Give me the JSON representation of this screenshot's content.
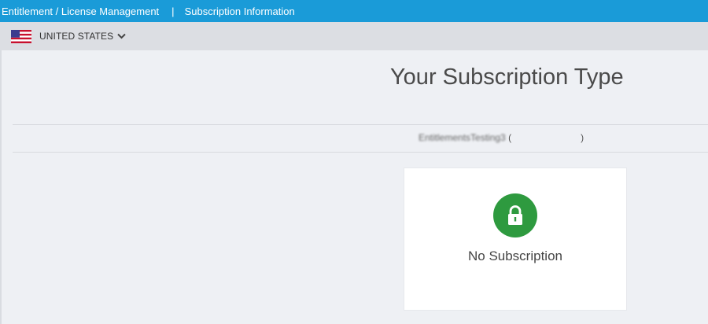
{
  "breadcrumb": {
    "item1": "Entitlement / License Management",
    "separator": "|",
    "item2": "Subscription Information"
  },
  "country": {
    "label": "UNITED STATES",
    "flag_icon": "us-flag-icon",
    "chevron_icon": "chevron-down-icon"
  },
  "main": {
    "title": "Your Subscription Type",
    "account_name": "EntitlementsTesting3",
    "account_open": "(",
    "account_close": ")",
    "subscription_status": "No Subscription",
    "status_icon": "lock-icon"
  },
  "colors": {
    "topbar": "#1a9bd8",
    "countrybar": "#dcdee3",
    "background": "#eef0f4",
    "lock_green": "#2e9a3f"
  }
}
